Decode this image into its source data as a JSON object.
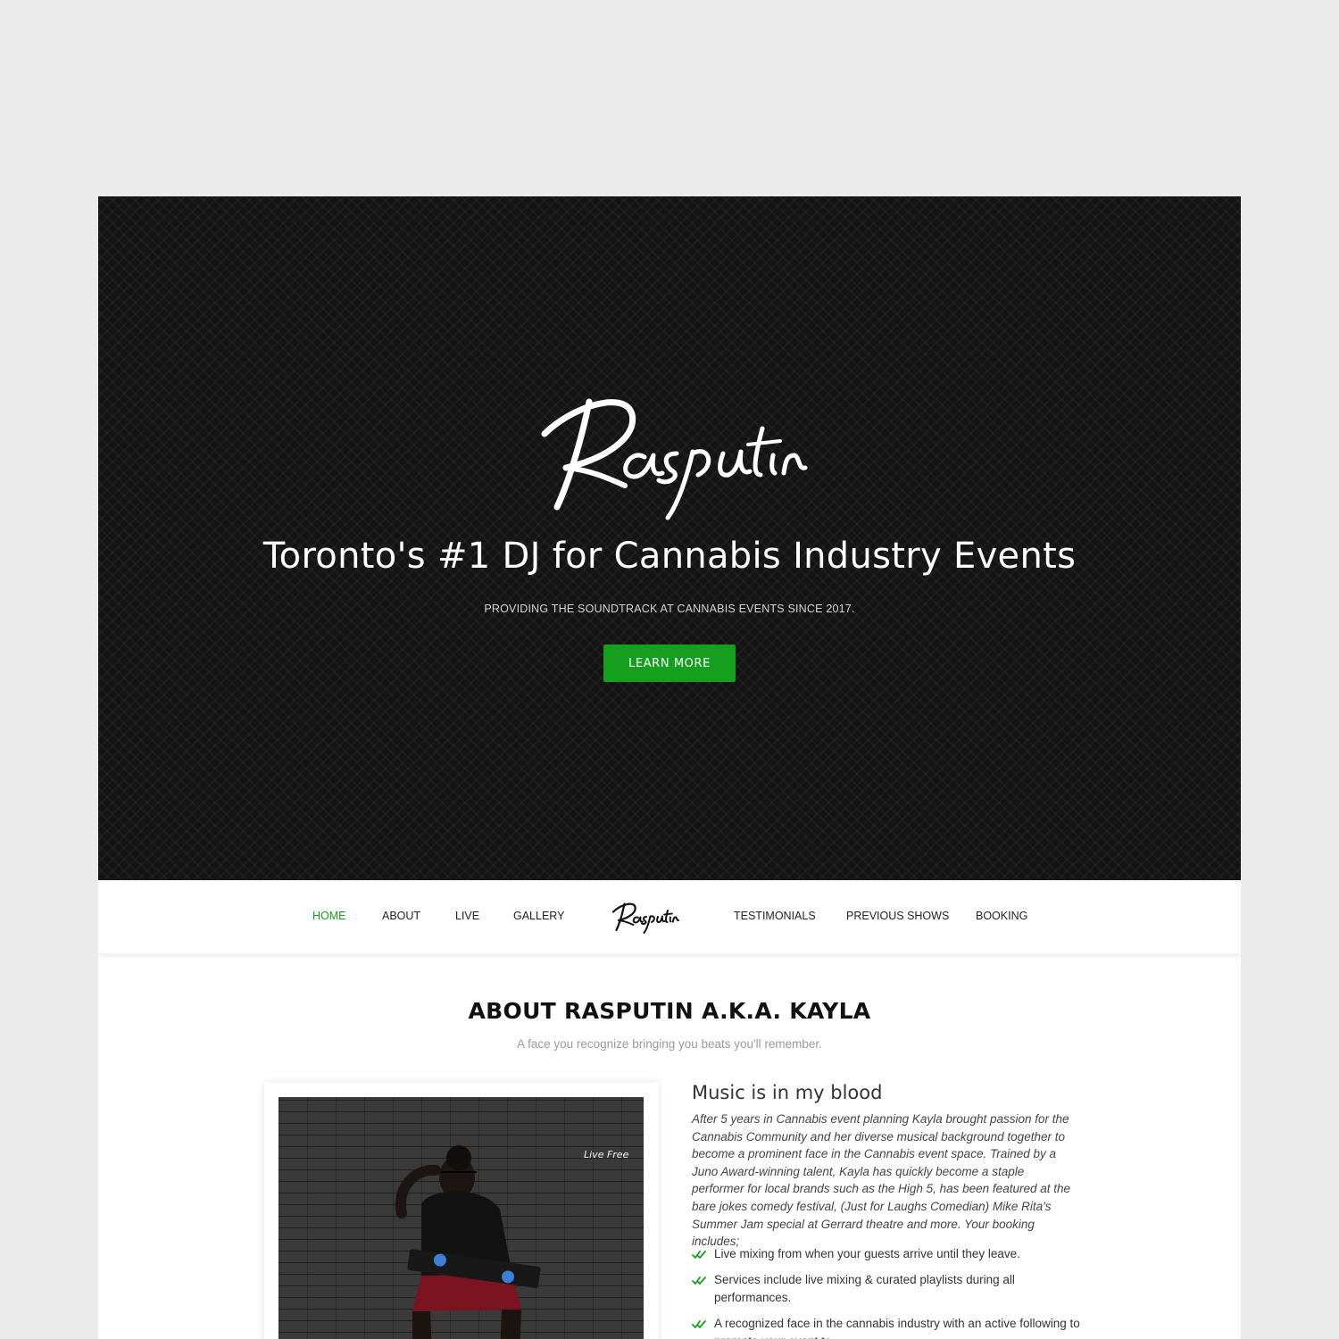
{
  "hero": {
    "logo_text": "Rasputin",
    "title": "Toronto's #1 DJ for Cannabis Industry Events",
    "subtitle": "PROVIDING THE SOUNDTRACK AT CANNABIS EVENTS SINCE 2017.",
    "button_label": "LEARN MORE"
  },
  "nav": {
    "items_left": [
      "HOME",
      "ABOUT",
      "LIVE",
      "GALLERY"
    ],
    "logo_text": "Rasputin",
    "items_right": [
      "TESTIMONIALS",
      "PREVIOUS SHOWS",
      "BOOKING"
    ],
    "active": "HOME"
  },
  "about": {
    "title": "ABOUT RASPUTIN A.K.A. KAYLA",
    "subtitle": "A face you recognize bringing you beats you'll remember.",
    "photo_wall_text": "Live Free",
    "heading": "Music is in my blood",
    "body": "After 5 years in Cannabis event planning Kayla brought passion for the Cannabis Community and her diverse musical background together to become a prominent face in the Cannabis event space. Trained by a Juno Award-winning talent, Kayla has quickly become a staple performer for local brands such as the High 5, has been featured at the bare jokes comedy festival, (Just for Laughs Comedian) Mike Rita's Summer Jam special at Gerrard theatre and more. Your booking includes;",
    "checklist": [
      "Live mixing from when your guests arrive until they leave.",
      "Services include live mixing & curated playlists during all performances.",
      "A recognized face in the cannabis industry with an active following to promote your event to."
    ]
  },
  "colors": {
    "accent": "#14a01e",
    "hero_bg": "#141414",
    "page_bg": "#ebebeb"
  },
  "icons": [
    "check-icon"
  ]
}
